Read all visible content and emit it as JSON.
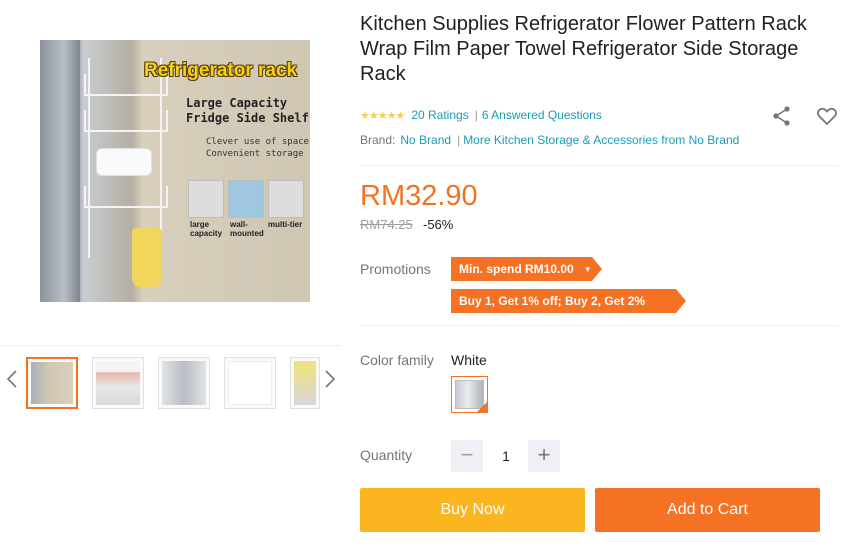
{
  "gallery": {
    "main_image": {
      "headline": "Refrigerator rack",
      "line1": "Large Capacity",
      "line2": "Fridge Side Shelf",
      "line3": "Clever use of space",
      "line4": "Convenient storage",
      "feature_labels": [
        "large capacity",
        "wall-mounted",
        "multi-tier"
      ]
    },
    "thumbnails": [
      {
        "name": "thumb-1",
        "active": true
      },
      {
        "name": "thumb-2",
        "active": false,
        "caption": "MULTI-FUNCTION"
      },
      {
        "name": "thumb-3",
        "active": false
      },
      {
        "name": "thumb-4",
        "active": false
      },
      {
        "name": "thumb-5",
        "active": false
      }
    ],
    "prev_icon": "chevron-left-icon",
    "next_icon": "chevron-right-icon"
  },
  "product": {
    "title": "Kitchen Supplies Refrigerator Flower Pattern Rack Wrap Film Paper Towel Refrigerator Side Storage Rack",
    "stars": "★★★★★",
    "ratings": "20 Ratings",
    "questions": "6 Answered Questions",
    "brand_label": "Brand:",
    "brand_value": "No Brand",
    "more_link": "More Kitchen Storage & Accessories from No Brand",
    "share_icon": "share-icon",
    "wishlist_icon": "heart-icon"
  },
  "pricing": {
    "price": "RM32.90",
    "original_price": "RM74.25",
    "discount": "-56%"
  },
  "promotions": {
    "label": "Promotions",
    "items": [
      "Min. spend RM10.00",
      "Buy 1, Get 1% off; Buy 2, Get 2% off"
    ]
  },
  "variation": {
    "label": "Color family",
    "value": "White"
  },
  "quantity": {
    "label": "Quantity",
    "value": "1",
    "minus": "−",
    "plus": "+"
  },
  "actions": {
    "buy_now": "Buy Now",
    "add_to_cart": "Add to Cart"
  },
  "colors": {
    "accent": "#f57224",
    "buy_now": "#fbb520",
    "link": "#1a9cb7",
    "star": "#faca51"
  }
}
